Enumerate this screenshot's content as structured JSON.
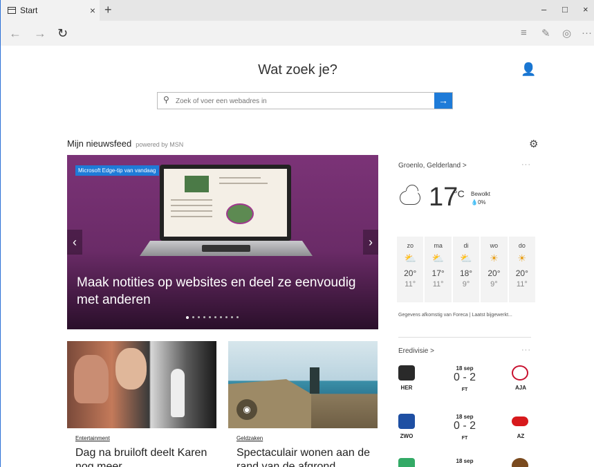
{
  "browser": {
    "tab_label": "Start",
    "tab_close": "×",
    "new_tab": "+",
    "minimize": "–",
    "maximize": "□",
    "close": "×",
    "back": "←",
    "forward": "→",
    "refresh": "↻",
    "more": "···"
  },
  "home": {
    "heading": "Wat zoek je?",
    "search_placeholder": "Zoek of voer een webadres in",
    "search_go": "→"
  },
  "feed": {
    "title": "Mijn nieuwsfeed",
    "powered": "powered by MSN"
  },
  "hero": {
    "badge": "Microsoft Edge-tip van vandaag",
    "headline": "Maak notities op websites en deel ze eenvoudig met anderen",
    "prev": "‹",
    "next": "›",
    "slide_count": 10,
    "active_slide": 1
  },
  "weather": {
    "location": "Groenlo, Gelderland >",
    "more": "···",
    "temperature": "17",
    "unit": "°C",
    "condition": "Bewolkt",
    "precipitation": "0%",
    "days": [
      {
        "name": "zo",
        "icon": "partly-cloudy-icon",
        "glyph": "⛅",
        "high": "20°",
        "low": "11°"
      },
      {
        "name": "ma",
        "icon": "partly-cloudy-icon",
        "glyph": "⛅",
        "high": "17°",
        "low": "11°"
      },
      {
        "name": "di",
        "icon": "partly-cloudy-icon",
        "glyph": "⛅",
        "high": "18°",
        "low": "9°"
      },
      {
        "name": "wo",
        "icon": "sunny-icon",
        "glyph": "☀",
        "high": "20°",
        "low": "9°"
      },
      {
        "name": "do",
        "icon": "sunny-icon",
        "glyph": "☀",
        "high": "20°",
        "low": "11°"
      }
    ],
    "source": "Gegevens afkomstig van Foreca | Laatst bijgewerkt..."
  },
  "football": {
    "league": "Eredivisie >",
    "more": "···",
    "matches": [
      {
        "date": "18 sep",
        "score": "0 - 2",
        "status": "FT",
        "home": "HER",
        "away": "AJA",
        "home_color": "#2a2a2a",
        "away_color": "#c8102e"
      },
      {
        "date": "18 sep",
        "score": "0 - 2",
        "status": "FT",
        "home": "ZWO",
        "away": "AZ",
        "home_color": "#1e4fa3",
        "away_color": "#d7191c"
      },
      {
        "date": "18 sep",
        "score": "",
        "status": "",
        "home": "",
        "away": "",
        "home_color": "#3a6",
        "away_color": "#7a4a1e"
      }
    ]
  },
  "articles": [
    {
      "category": "Entertainment",
      "title": "Dag na bruiloft deelt Karen nog meer"
    },
    {
      "category": "Geldzaken",
      "title": "Spectaculair wonen aan de rand van de afgrond"
    }
  ],
  "colors": {
    "accent": "#1e7bd8",
    "hero_bg": "#7b3377"
  }
}
